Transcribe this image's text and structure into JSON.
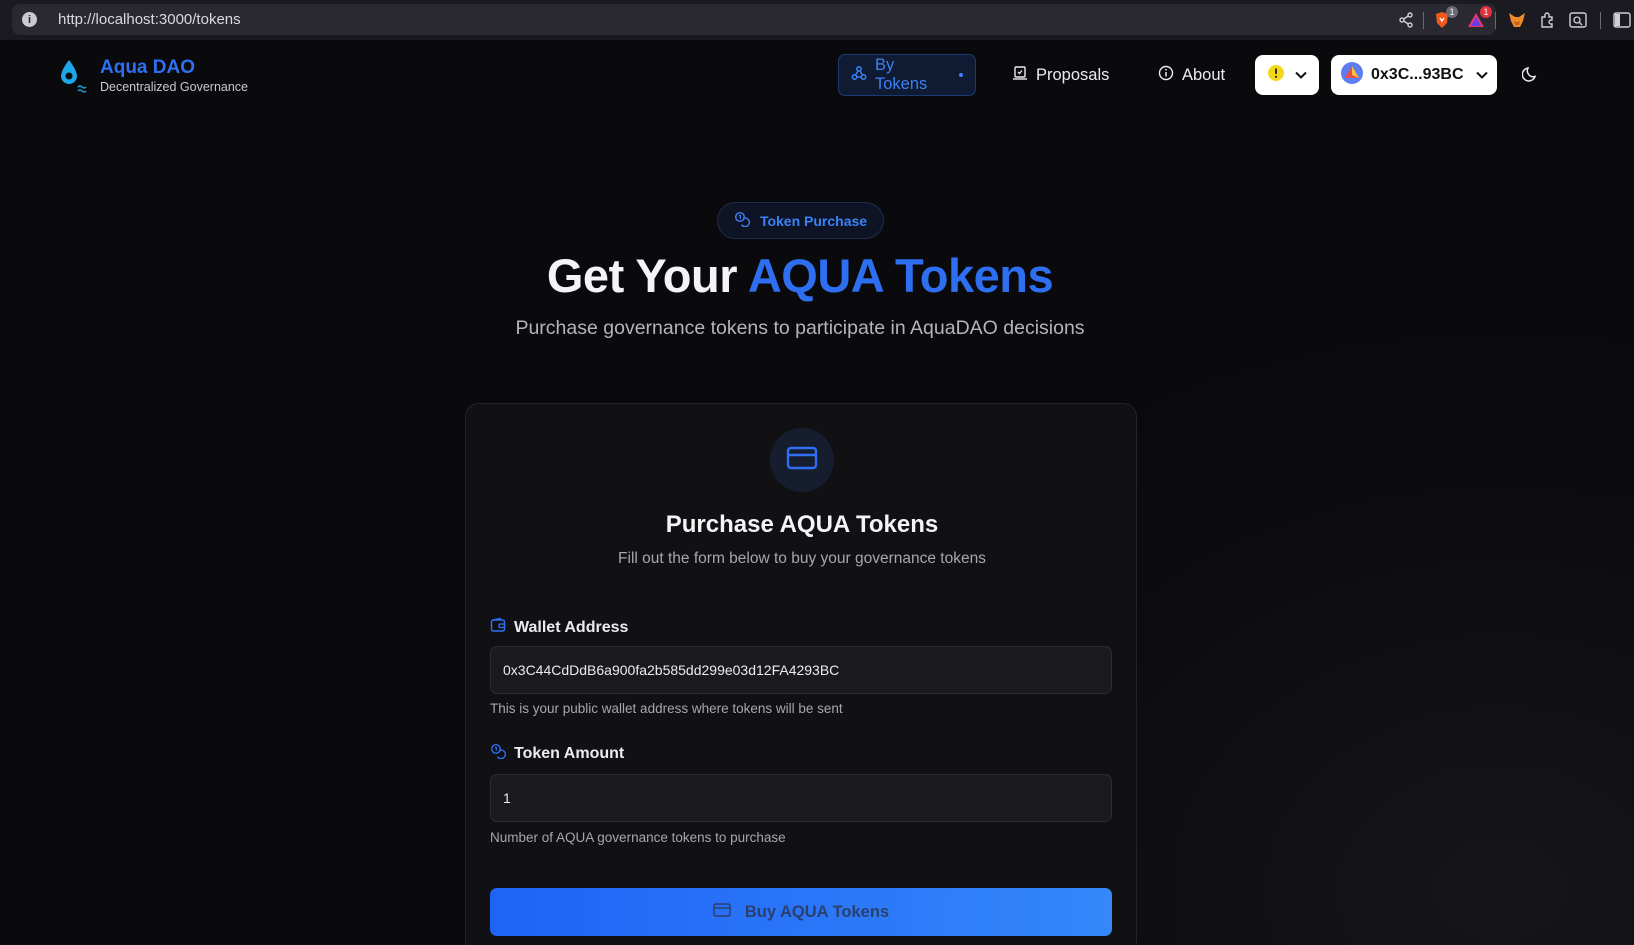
{
  "browser": {
    "url": "http://localhost:3000/tokens",
    "brave_badge": "1",
    "alert_badge": "1"
  },
  "nav": {
    "brand_title": "Aqua DAO",
    "brand_subtitle": "Decentralized Governance",
    "items": [
      {
        "label": "By Tokens",
        "icon": "webhook-icon",
        "active": true
      },
      {
        "label": "Proposals",
        "icon": "proposals-icon",
        "active": false
      },
      {
        "label": "About",
        "icon": "info-icon",
        "active": false
      }
    ],
    "account": "0x3C...93BC",
    "accent": "#2e6ff2"
  },
  "hero": {
    "badge": "Token Purchase",
    "title_prefix": "Get Your",
    "title_accent": "AQUA Tokens",
    "subtitle": "Purchase governance tokens to participate in AquaDAO decisions"
  },
  "card": {
    "title": "Purchase AQUA Tokens",
    "subtitle": "Fill out the form below to buy your governance tokens",
    "wallet_label": "Wallet Address",
    "wallet_value": "0x3C44CdDdB6a900fa2b585dd299e03d12FA4293BC",
    "wallet_help": "This is your public wallet address where tokens will be sent",
    "amount_label": "Token Amount",
    "amount_value": "1",
    "amount_help": "Number of AQUA governance tokens to purchase",
    "button_label": "Buy AQUA Tokens"
  }
}
